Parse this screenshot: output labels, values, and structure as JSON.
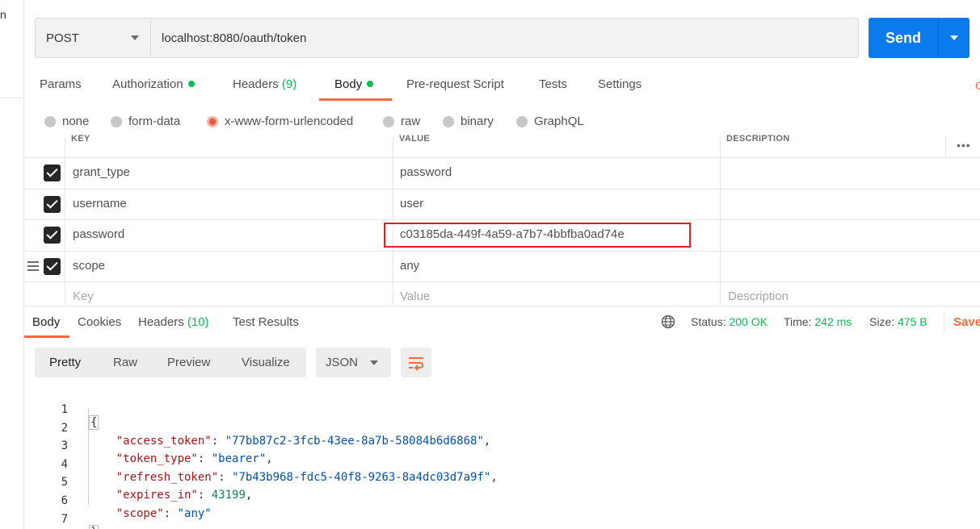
{
  "sidebar": {
    "fragment_text": "n"
  },
  "request": {
    "method": "POST",
    "url": "localhost:8080/oauth/token",
    "send_label": "Send"
  },
  "tabs": {
    "params": "Params",
    "authorization": "Authorization",
    "headers": "Headers",
    "headers_count": "(9)",
    "body": "Body",
    "pre_request": "Pre-request Script",
    "tests": "Tests",
    "settings": "Settings"
  },
  "body_types": {
    "none": "none",
    "form_data": "form-data",
    "urlencoded": "x-www-form-urlencoded",
    "raw": "raw",
    "binary": "binary",
    "graphql": "GraphQL",
    "selected": "x-www-form-urlencoded"
  },
  "params_table": {
    "headers": {
      "key": "KEY",
      "value": "VALUE",
      "description": "DESCRIPTION"
    },
    "rows": [
      {
        "key": "grant_type",
        "value": "password",
        "checked": true
      },
      {
        "key": "username",
        "value": "user",
        "checked": true
      },
      {
        "key": "password",
        "value": "c03185da-449f-4a59-a7b7-4bbfba0ad74e",
        "checked": true
      },
      {
        "key": "scope",
        "value": "any",
        "checked": true
      }
    ],
    "placeholders": {
      "key": "Key",
      "value": "Value",
      "description": "Description"
    }
  },
  "response": {
    "tabs": {
      "body": "Body",
      "cookies": "Cookies",
      "headers": "Headers",
      "headers_count": "(10)",
      "test_results": "Test Results"
    },
    "status_label": "Status:",
    "status_value": "200 OK",
    "time_label": "Time:",
    "time_value": "242 ms",
    "size_label": "Size:",
    "size_value": "475 B",
    "save_label": "Save",
    "view_modes": [
      "Pretty",
      "Raw",
      "Preview",
      "Visualize"
    ],
    "format": "JSON",
    "code_lines": {
      "l1": "{",
      "l2_key": "\"access_token\"",
      "l2_val": "\"77bb87c2-3fcb-43ee-8a7b-58084b6d6868\"",
      "l3_key": "\"token_type\"",
      "l3_val": "\"bearer\"",
      "l4_key": "\"refresh_token\"",
      "l4_val": "\"7b43b968-fdc5-40f8-9263-8a4dc03d7a9f\"",
      "l5_key": "\"expires_in\"",
      "l5_val": "43199",
      "l6_key": "\"scope\"",
      "l6_val": "\"any\"",
      "l7": "}"
    },
    "line_numbers": [
      "1",
      "2",
      "3",
      "4",
      "5",
      "6",
      "7"
    ]
  },
  "colors": {
    "accent_orange": "#f26b3a",
    "send_blue": "#097bed",
    "success_green": "#0cbb52",
    "highlight_red": "#e02020"
  },
  "icons": {
    "method_caret": "chevron-down-icon",
    "send_caret": "chevron-down-icon",
    "globe": "globe-icon",
    "wrap": "wrap-lines-icon",
    "drag": "drag-handle-icon",
    "more": "more-horizontal-icon",
    "checkbox": "checkbox-checked-icon"
  }
}
